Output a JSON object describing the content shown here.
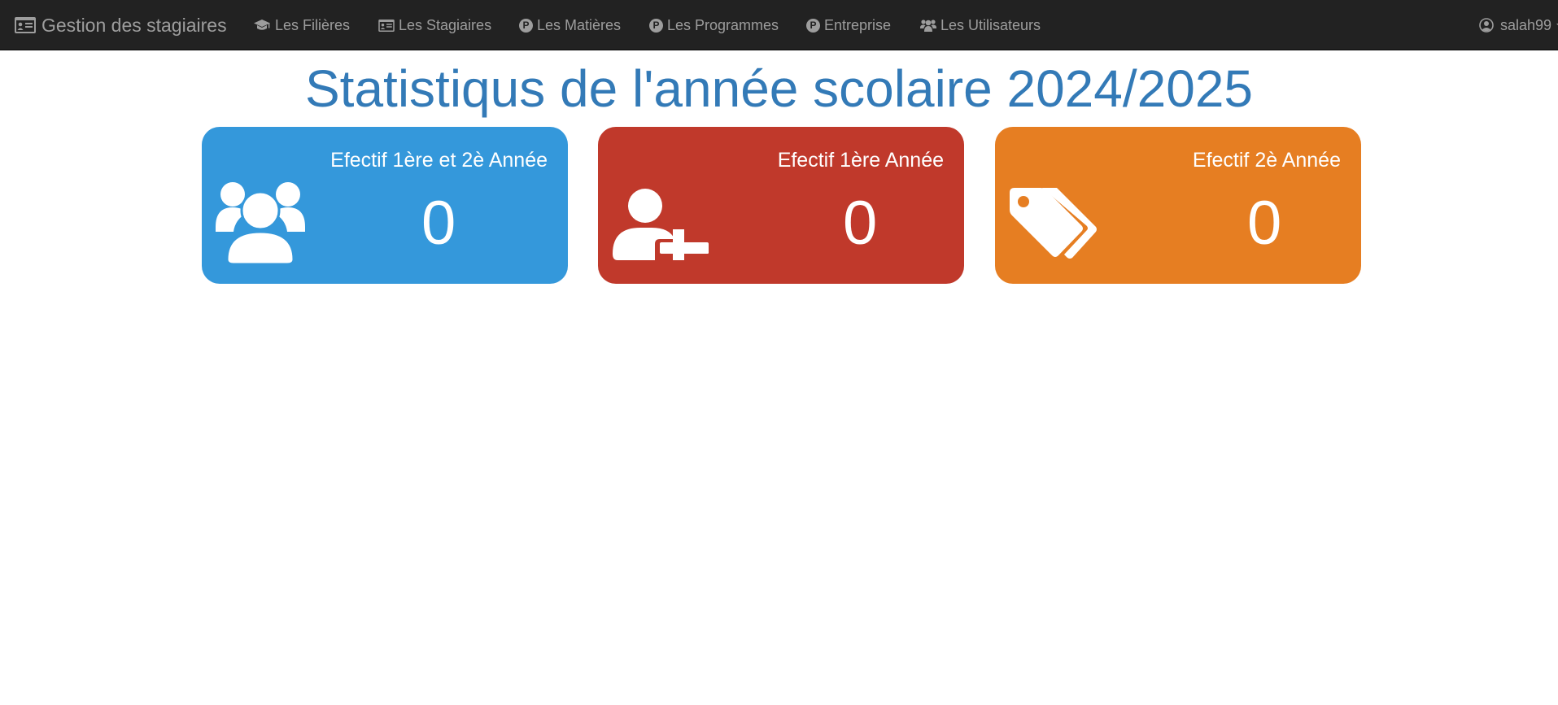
{
  "navbar": {
    "brand": "Gestion des stagiaires",
    "items": [
      {
        "label": "Les Filières",
        "icon": "graduation-cap-icon"
      },
      {
        "label": "Les Stagiaires",
        "icon": "id-card-icon"
      },
      {
        "label": "Les Matières",
        "icon": "p-circle-icon"
      },
      {
        "label": "Les Programmes",
        "icon": "p-circle-icon"
      },
      {
        "label": "Entreprise",
        "icon": "p-circle-icon"
      },
      {
        "label": "Les Utilisateurs",
        "icon": "users-icon"
      }
    ],
    "user": "salah99"
  },
  "page": {
    "title": "Statistiqus de l'année scolaire 2024/2025"
  },
  "cards": [
    {
      "label": "Efectif 1ère et 2è Année",
      "value": "0",
      "icon": "users-icon",
      "color": "#3498db"
    },
    {
      "label": "Efectif 1ère Année",
      "value": "0",
      "icon": "user-plus-icon",
      "color": "#c0392b"
    },
    {
      "label": "Efectif 2è Année",
      "value": "0",
      "icon": "tags-icon",
      "color": "#e67e22"
    }
  ],
  "colors": {
    "navbar_bg": "#222222",
    "navbar_text": "#9d9d9d",
    "title": "#337ab7"
  }
}
